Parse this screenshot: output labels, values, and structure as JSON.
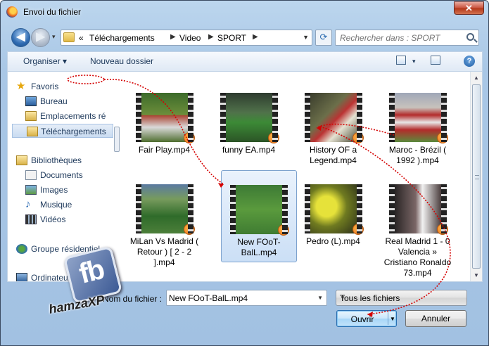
{
  "window": {
    "title": "Envoi du fichier",
    "close_glyph": "✕"
  },
  "nav": {
    "back_glyph": "◀",
    "forward_glyph": "▶",
    "breadcrumb_prefix": "«",
    "breadcrumbs": [
      "Téléchargements",
      "Video",
      "SPORT"
    ],
    "search_placeholder": "Rechercher dans : SPORT"
  },
  "toolbar": {
    "organize_label": "Organiser ▾",
    "new_folder_label": "Nouveau dossier",
    "view_arrow": "▾",
    "help_glyph": "?"
  },
  "sidebar": {
    "favorites": "Favoris",
    "fav_items": [
      "Bureau",
      "Emplacements ré",
      "Téléchargements"
    ],
    "libraries": "Bibliothèques",
    "lib_items": [
      "Documents",
      "Images",
      "Musique",
      "Vidéos"
    ],
    "homegroup": "Groupe résidentiel",
    "computer": "Ordinateur"
  },
  "files": [
    {
      "name": "Fair Play.mp4",
      "icon": "video-thumbnail"
    },
    {
      "name": "funny EA.mp4",
      "icon": "video-thumbnail"
    },
    {
      "name": "History OF a Legend.mp4",
      "icon": "video-thumbnail"
    },
    {
      "name": "Maroc - Brézil ( 1992 ).mp4",
      "icon": "video-thumbnail"
    },
    {
      "name": "MiLan Vs Madrid ( Retour ) [ 2 - 2 ].mp4",
      "icon": "video-thumbnail"
    },
    {
      "name": "New FOoT-BalL.mp4",
      "icon": "video-thumbnail",
      "selected": true
    },
    {
      "name": "Pedro (L).mp4",
      "icon": "video-thumbnail"
    },
    {
      "name": "Real Madrid 1 - 0 Valencia » Cristiano Ronaldo 73.mp4",
      "icon": "video-thumbnail"
    }
  ],
  "footer": {
    "filename_label": "Nom du fichier :",
    "filename_value": "New FOoT-BalL.mp4",
    "filter_value": "Tous les fichiers",
    "open_label": "Ouvrir",
    "cancel_label": "Annuler"
  },
  "watermark": {
    "logo": "fb",
    "name": "hamzaXP"
  },
  "colors": {
    "annotation": "#d40000",
    "selection": "#cbdff6",
    "accent": "#2a6fb1"
  }
}
